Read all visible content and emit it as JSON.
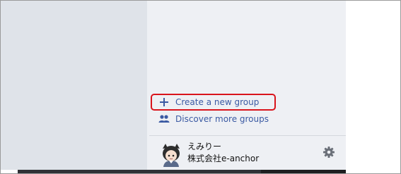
{
  "groups_panel": {
    "create_label": "Create a new group",
    "discover_label": "Discover more groups"
  },
  "user": {
    "name": "えみりー",
    "organization": "株式会社e-anchor"
  },
  "colors": {
    "link": "#3b5aa3",
    "highlight": "#d9141c",
    "panel_background": "#eef0f4",
    "left_background": "#dfe3e9"
  }
}
